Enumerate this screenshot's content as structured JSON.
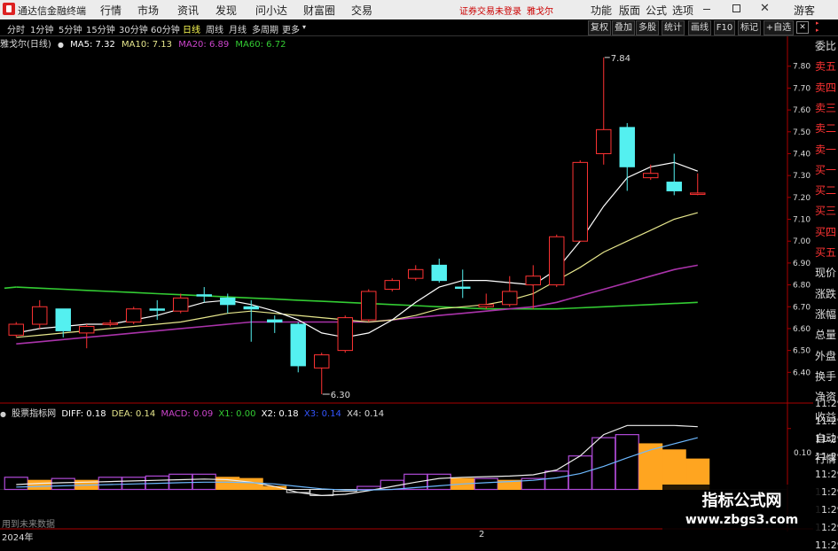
{
  "app": {
    "title": "通达信金融终端"
  },
  "menu": [
    "行情",
    "市场",
    "资讯",
    "发现",
    "问小达",
    "财富圈",
    "交易"
  ],
  "notice": {
    "login": "证券交易未登录",
    "stock": "雅戈尔"
  },
  "menu_right": [
    "功能",
    "版面",
    "公式",
    "选项"
  ],
  "guest": "游客",
  "periods": [
    "分时",
    "1分钟",
    "5分钟",
    "15分钟",
    "30分钟",
    "60分钟",
    "日线",
    "周线",
    "月线",
    "多周期",
    "更多"
  ],
  "active_period": "日线",
  "toolbar_buttons": [
    "复权",
    "叠加",
    "多股",
    "统计",
    "画线",
    "F10",
    "标记",
    "+自选"
  ],
  "ma_header": {
    "title": "雅戈尔(日线)",
    "ma5": "MA5: 7.32",
    "ma10": "MA10: 7.13",
    "ma20": "MA20: 6.89",
    "ma60": "MA60: 6.72",
    "colors": {
      "ma5": "#ffffff",
      "ma10": "#e6e68c",
      "ma20": "#cc44cc",
      "ma60": "#33cc33"
    }
  },
  "right_panel": [
    "委比",
    "卖五",
    "卖四",
    "卖三",
    "卖二",
    "卖一",
    "买一",
    "买二",
    "买三",
    "买四",
    "买五",
    "现价",
    "涨跌",
    "涨幅",
    "总量",
    "外盘",
    "换手",
    "净资",
    "收益",
    "自动",
    "行情"
  ],
  "right_times": [
    "11:29",
    "11:29",
    "11:29",
    "11:29",
    "11:29",
    "11:29",
    "11:29",
    "11:29",
    "11:29"
  ],
  "price_axis": [
    "7.80",
    "7.70",
    "7.60",
    "7.50",
    "7.40",
    "7.30",
    "7.20",
    "7.10",
    "7.00",
    "6.90",
    "6.80",
    "6.70",
    "6.60",
    "6.50",
    "6.40"
  ],
  "annotations": {
    "high": "7.84",
    "low": "6.30"
  },
  "macd_header": {
    "title": "股票指标网",
    "diff": "DIFF: 0.18",
    "dea": "DEA: 0.14",
    "macd": "MACD: 0.09",
    "x1": "X1: 0.00",
    "x2": "X2: 0.18",
    "x3": "X3: 0.14",
    "x4": "X4: 0.14"
  },
  "macd_axis": [
    "0.10"
  ],
  "bottom": {
    "nofuture": "用到未来数据",
    "date1": "2024年",
    "date2": "2"
  },
  "watermark": {
    "line1": "指标公式网",
    "line2": "www.zbgs3.com"
  },
  "chart_data": {
    "type": "candlestick",
    "ylim": [
      6.3,
      7.88
    ],
    "candles": [
      {
        "o": 6.57,
        "h": 6.63,
        "l": 6.56,
        "c": 6.62
      },
      {
        "o": 6.62,
        "h": 6.73,
        "l": 6.6,
        "c": 6.7
      },
      {
        "o": 6.69,
        "h": 6.69,
        "l": 6.56,
        "c": 6.59
      },
      {
        "o": 6.58,
        "h": 6.62,
        "l": 6.51,
        "c": 6.61
      },
      {
        "o": 6.62,
        "h": 6.64,
        "l": 6.61,
        "c": 6.625
      },
      {
        "o": 6.63,
        "h": 6.7,
        "l": 6.62,
        "c": 6.69
      },
      {
        "o": 6.69,
        "h": 6.73,
        "l": 6.64,
        "c": 6.685
      },
      {
        "o": 6.68,
        "h": 6.76,
        "l": 6.67,
        "c": 6.74
      },
      {
        "o": 6.755,
        "h": 6.79,
        "l": 6.72,
        "c": 6.75
      },
      {
        "o": 6.74,
        "h": 6.76,
        "l": 6.67,
        "c": 6.71
      },
      {
        "o": 6.7,
        "h": 6.73,
        "l": 6.54,
        "c": 6.69
      },
      {
        "o": 6.64,
        "h": 6.66,
        "l": 6.58,
        "c": 6.63
      },
      {
        "o": 6.62,
        "h": 6.63,
        "l": 6.4,
        "c": 6.43
      },
      {
        "o": 6.42,
        "h": 6.49,
        "l": 6.3,
        "c": 6.48
      },
      {
        "o": 6.5,
        "h": 6.66,
        "l": 6.49,
        "c": 6.65
      },
      {
        "o": 6.64,
        "h": 6.78,
        "l": 6.63,
        "c": 6.77
      },
      {
        "o": 6.78,
        "h": 6.83,
        "l": 6.77,
        "c": 6.82
      },
      {
        "o": 6.83,
        "h": 6.89,
        "l": 6.82,
        "c": 6.87
      },
      {
        "o": 6.89,
        "h": 6.92,
        "l": 6.81,
        "c": 6.82
      },
      {
        "o": 6.79,
        "h": 6.87,
        "l": 6.74,
        "c": 6.785
      },
      {
        "o": 6.7,
        "h": 6.76,
        "l": 6.69,
        "c": 6.71
      },
      {
        "o": 6.71,
        "h": 6.84,
        "l": 6.7,
        "c": 6.77
      },
      {
        "o": 6.8,
        "h": 6.89,
        "l": 6.69,
        "c": 6.84
      },
      {
        "o": 6.8,
        "h": 7.03,
        "l": 6.79,
        "c": 7.02
      },
      {
        "o": 7.0,
        "h": 7.37,
        "l": 7.0,
        "c": 7.36
      },
      {
        "o": 7.4,
        "h": 7.84,
        "l": 7.35,
        "c": 7.51
      },
      {
        "o": 7.52,
        "h": 7.54,
        "l": 7.23,
        "c": 7.34
      },
      {
        "o": 7.29,
        "h": 7.35,
        "l": 7.28,
        "c": 7.31
      },
      {
        "o": 7.27,
        "h": 7.4,
        "l": 7.21,
        "c": 7.23
      },
      {
        "o": 7.22,
        "h": 7.31,
        "l": 7.21,
        "c": 7.22
      }
    ],
    "ma5": [
      6.58,
      6.6,
      6.61,
      6.62,
      6.62,
      6.64,
      6.66,
      6.69,
      6.72,
      6.73,
      6.71,
      6.68,
      6.64,
      6.58,
      6.56,
      6.58,
      6.64,
      6.72,
      6.79,
      6.82,
      6.82,
      6.81,
      6.8,
      6.87,
      7.0,
      7.16,
      7.29,
      7.34,
      7.36,
      7.32
    ],
    "ma10": [
      6.56,
      6.57,
      6.58,
      6.59,
      6.6,
      6.61,
      6.62,
      6.63,
      6.65,
      6.67,
      6.68,
      6.67,
      6.66,
      6.65,
      6.64,
      6.63,
      6.64,
      6.66,
      6.69,
      6.7,
      6.71,
      6.73,
      6.76,
      6.82,
      6.88,
      6.95,
      7.0,
      7.05,
      7.1,
      7.13
    ],
    "ma20": [
      6.53,
      6.54,
      6.55,
      6.56,
      6.57,
      6.58,
      6.59,
      6.6,
      6.61,
      6.62,
      6.63,
      6.63,
      6.63,
      6.63,
      6.63,
      6.63,
      6.64,
      6.65,
      6.66,
      6.67,
      6.68,
      6.69,
      6.7,
      6.72,
      6.75,
      6.78,
      6.81,
      6.84,
      6.87,
      6.89
    ],
    "ma60": [
      6.79,
      6.785,
      6.78,
      6.775,
      6.77,
      6.765,
      6.76,
      6.755,
      6.75,
      6.745,
      6.74,
      6.735,
      6.73,
      6.725,
      6.72,
      6.715,
      6.71,
      6.705,
      6.7,
      6.695,
      6.69,
      6.69,
      6.69,
      6.69,
      6.695,
      6.7,
      6.705,
      6.71,
      6.715,
      6.72
    ],
    "macd": {
      "ylim": [
        -0.04,
        0.12
      ],
      "hist": [
        0.02,
        0.015,
        0.018,
        0.015,
        0.02,
        0.02,
        0.022,
        0.025,
        0.025,
        0.02,
        0.018,
        0.005,
        -0.005,
        -0.01,
        -0.003,
        0.005,
        0.015,
        0.025,
        0.025,
        0.018,
        0.018,
        0.015,
        0.018,
        0.03,
        0.055,
        0.085,
        0.09,
        0.075,
        0.065,
        0.05
      ],
      "diff": [
        0.008,
        0.01,
        0.011,
        0.012,
        0.013,
        0.014,
        0.015,
        0.016,
        0.017,
        0.016,
        0.012,
        0.005,
        -0.005,
        -0.01,
        -0.008,
        -0.002,
        0.005,
        0.012,
        0.018,
        0.02,
        0.021,
        0.022,
        0.024,
        0.032,
        0.055,
        0.09,
        0.105,
        0.105,
        0.105,
        0.103
      ],
      "dea": [
        0.004,
        0.005,
        0.006,
        0.007,
        0.008,
        0.009,
        0.01,
        0.011,
        0.012,
        0.012,
        0.011,
        0.009,
        0.005,
        0.001,
        -0.001,
        -0.001,
        0.0,
        0.003,
        0.006,
        0.009,
        0.011,
        0.013,
        0.015,
        0.019,
        0.026,
        0.038,
        0.052,
        0.065,
        0.075,
        0.085
      ]
    }
  }
}
